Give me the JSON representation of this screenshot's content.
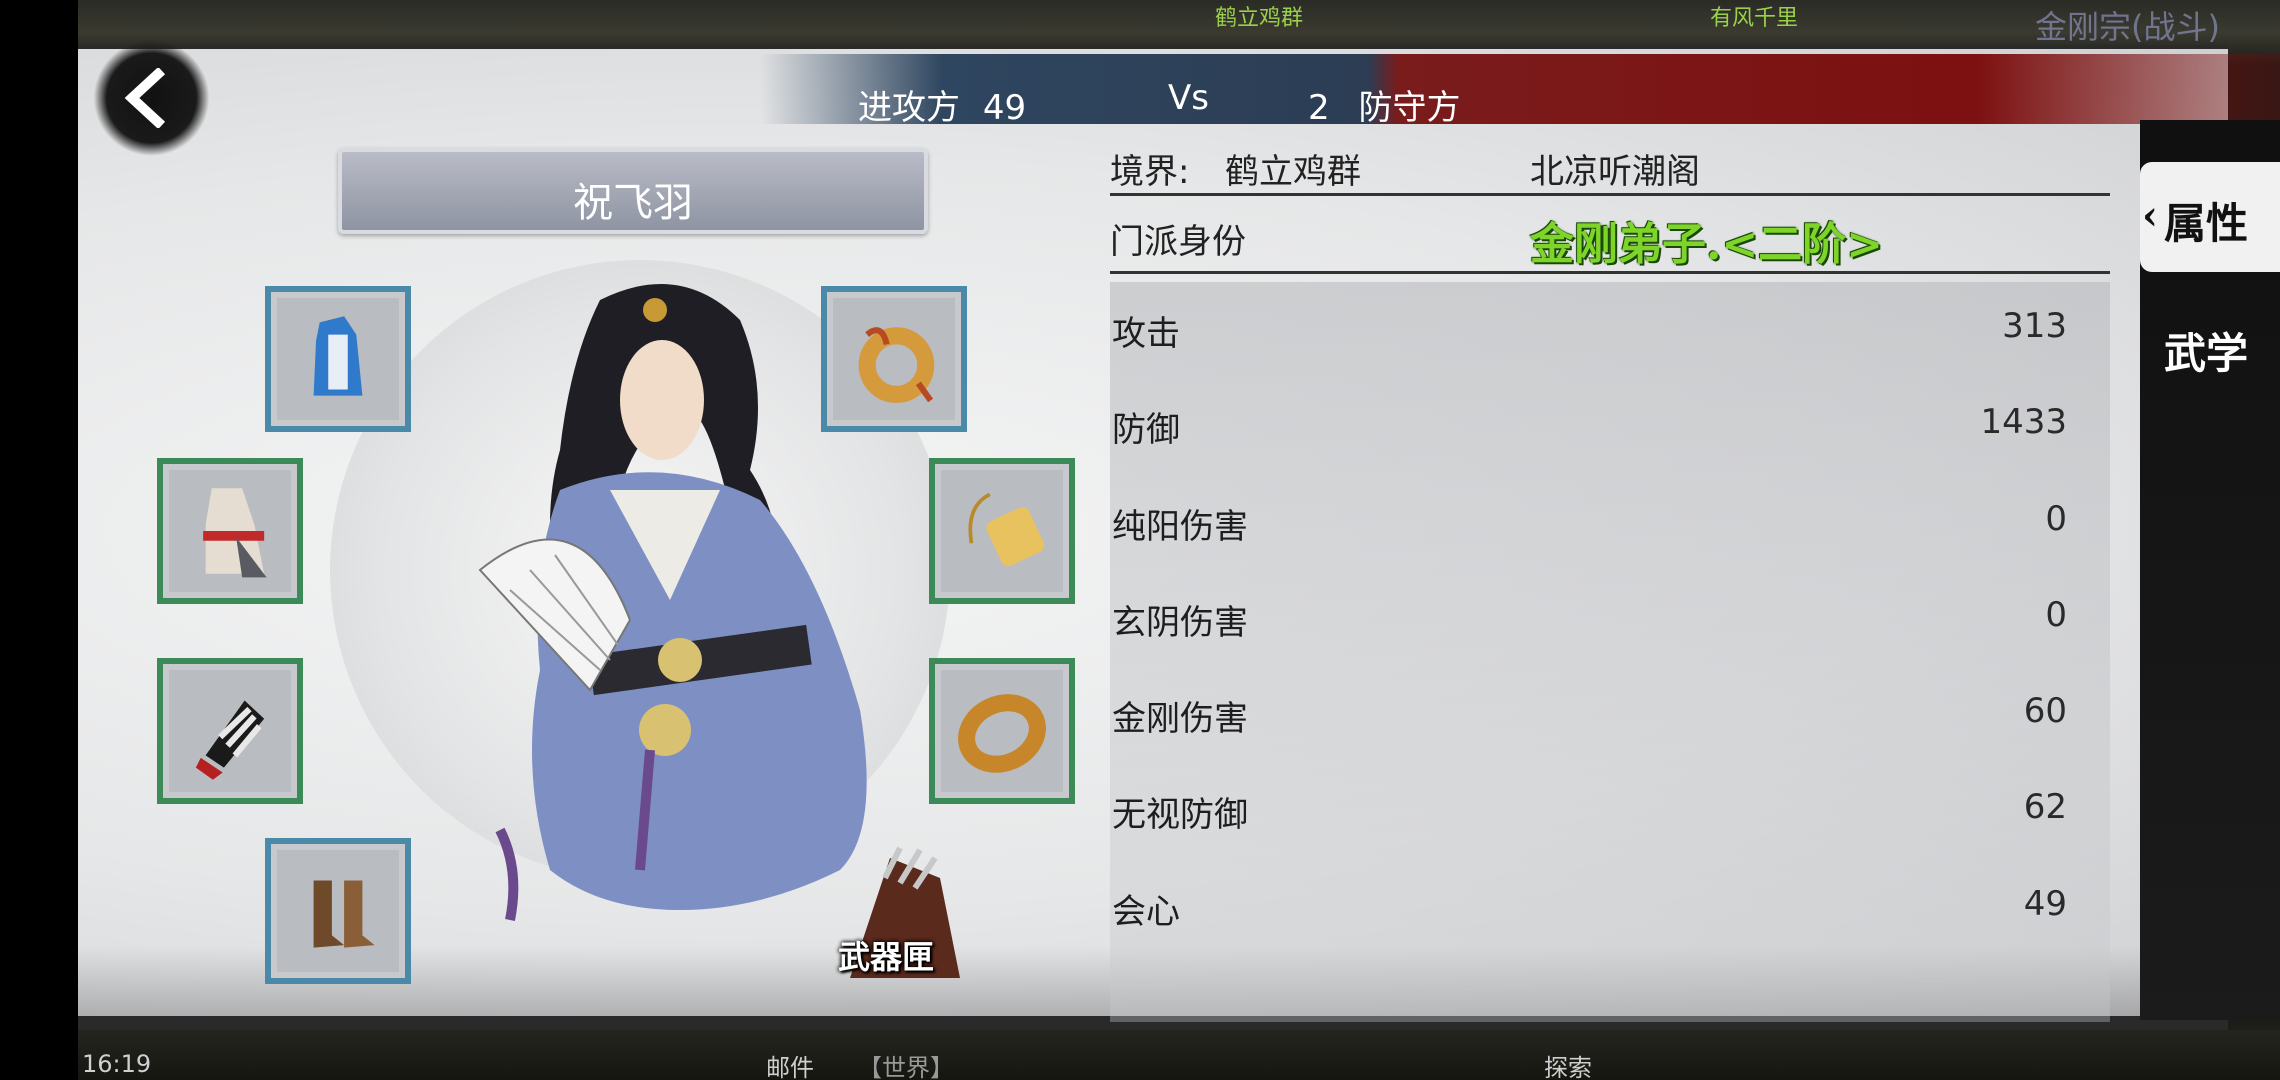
{
  "background": {
    "top_texts": [
      "鹤立鸡群",
      "有风千里"
    ],
    "top_right_text": "金刚宗(战斗)",
    "bottom_items": [
      "邮件",
      "【世界】",
      "探索"
    ]
  },
  "header": {
    "attacker_label": "进攻方",
    "attacker_value": "49",
    "vs_label": "Vs",
    "defender_value": "2",
    "defender_label": "防守方"
  },
  "character": {
    "name": "祝飞羽",
    "weapon_box_label": "武器匣"
  },
  "equipment": {
    "slots": [
      {
        "name": "robe-blue-slot",
        "icon": "robe-icon"
      },
      {
        "name": "amulet-slot",
        "icon": "jade-pendant-icon"
      },
      {
        "name": "clothes-slot",
        "icon": "clothes-icon"
      },
      {
        "name": "token-slot",
        "icon": "gold-token-icon"
      },
      {
        "name": "bracer-slot",
        "icon": "bracer-icon"
      },
      {
        "name": "ring-slot",
        "icon": "gold-ring-icon"
      },
      {
        "name": "boots-slot",
        "icon": "boots-icon"
      }
    ]
  },
  "stats": {
    "realm_label": "境界:",
    "realm_value": "鹤立鸡群",
    "sect_location": "北凉听潮阁",
    "sect_identity_label": "门派身份",
    "sect_identity_value": "金刚弟子.<二阶>",
    "rows": [
      {
        "label": "攻击",
        "value": "313"
      },
      {
        "label": "防御",
        "value": "1433"
      },
      {
        "label": "纯阳伤害",
        "value": "0"
      },
      {
        "label": "玄阴伤害",
        "value": "0"
      },
      {
        "label": "金刚伤害",
        "value": "60"
      },
      {
        "label": "无视防御",
        "value": "62"
      },
      {
        "label": "会心",
        "value": "49"
      }
    ]
  },
  "tabs": {
    "attributes": "属性",
    "martial": "武学"
  },
  "status": {
    "clock": "16:19"
  },
  "colors": {
    "attacker_bg": "#2f4660",
    "defender_bg": "#7d1010",
    "sect_identity_green": "#7fd42a",
    "slot_blue": "#4a8aa8",
    "slot_green": "#3c8a58"
  }
}
